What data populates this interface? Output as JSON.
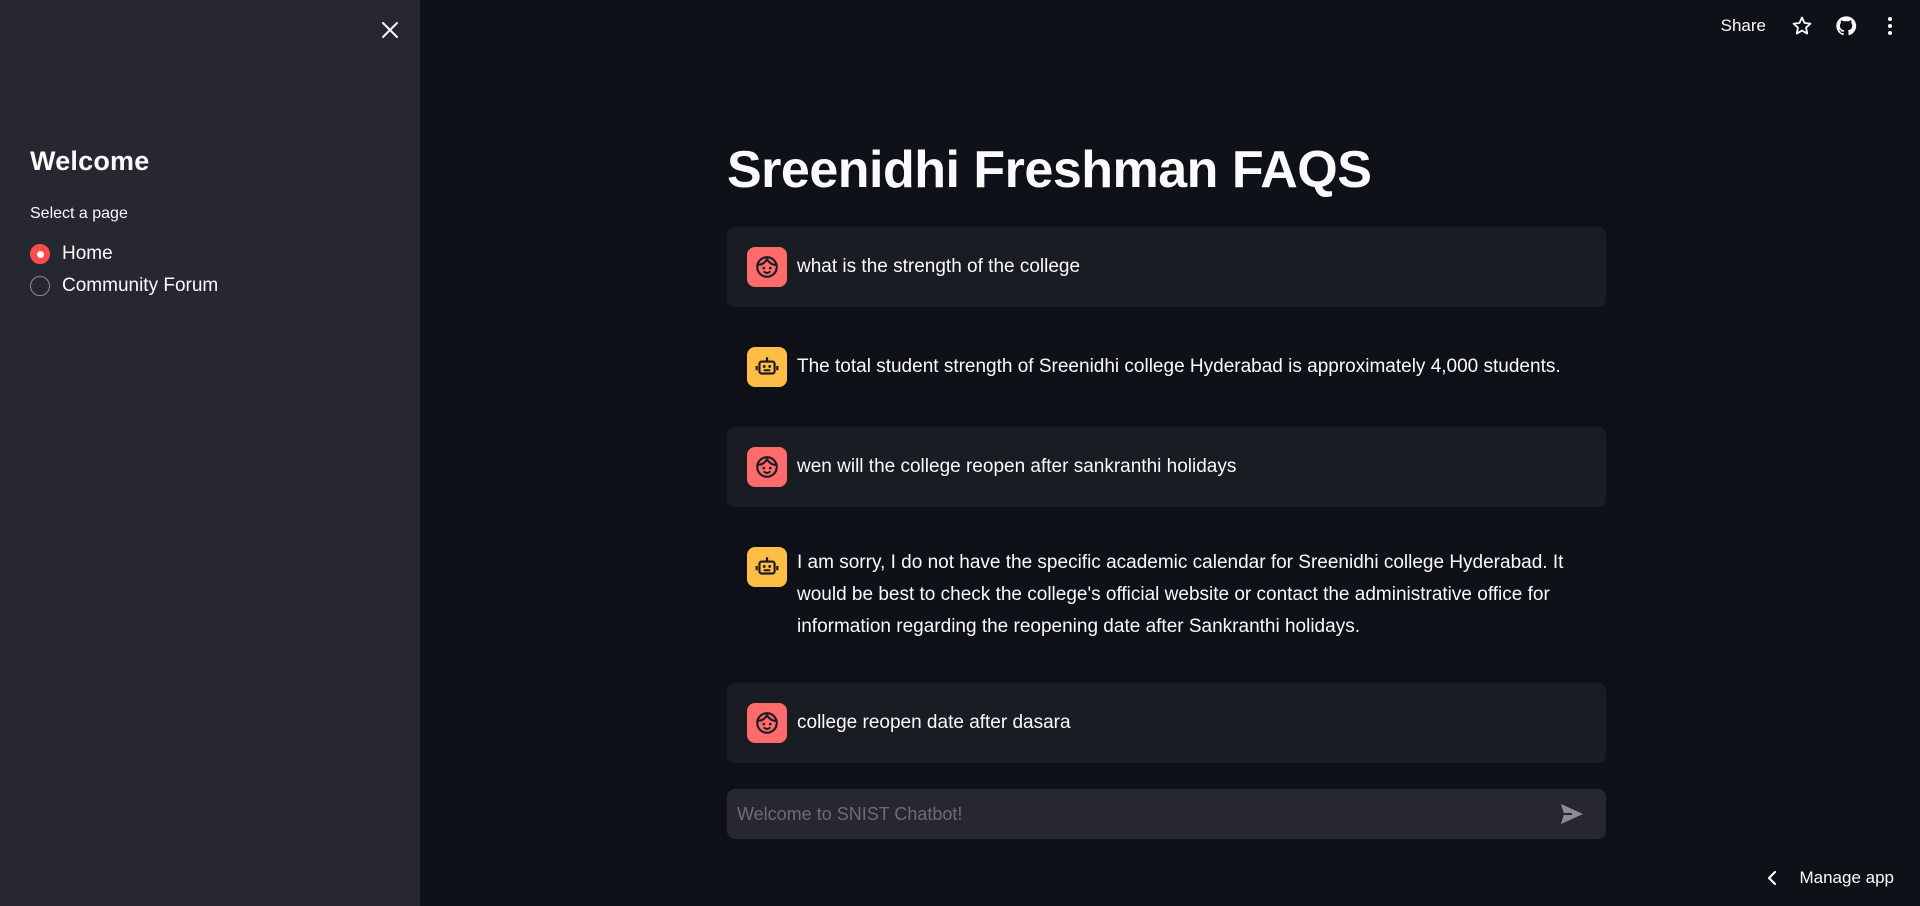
{
  "sidebar": {
    "title": "Welcome",
    "radio_label": "Select a page",
    "options": [
      {
        "label": "Home",
        "selected": true
      },
      {
        "label": "Community Forum",
        "selected": false
      }
    ]
  },
  "toolbar": {
    "share_label": "Share",
    "icons": [
      "star-icon",
      "github-icon",
      "kebab-menu-icon"
    ]
  },
  "main": {
    "title": "Sreenidhi Freshman FAQS",
    "messages": [
      {
        "role": "user",
        "text": "what is the strength of the college"
      },
      {
        "role": "assistant",
        "text": "The total student strength of Sreenidhi college Hyderabad is approximately 4,000 students."
      },
      {
        "role": "user",
        "text": "wen will the college reopen after sankranthi holidays"
      },
      {
        "role": "assistant",
        "text": "I am sorry, I do not have the specific academic calendar for Sreenidhi college Hyderabad. It would be best to check the college's official website or contact the administrative office for information regarding the reopening date after Sankranthi holidays."
      },
      {
        "role": "user",
        "text": "college reopen date after dasara"
      }
    ]
  },
  "chat_input": {
    "placeholder": "Welcome to SNIST Chatbot!",
    "value": ""
  },
  "footer": {
    "manage_app_label": "Manage app"
  },
  "colors": {
    "accent": "#ff4b4b",
    "user_avatar": "#ff6b6b",
    "bot_avatar": "#ffbd45",
    "background": "#0e1117",
    "sidebar_bg": "#262730"
  }
}
